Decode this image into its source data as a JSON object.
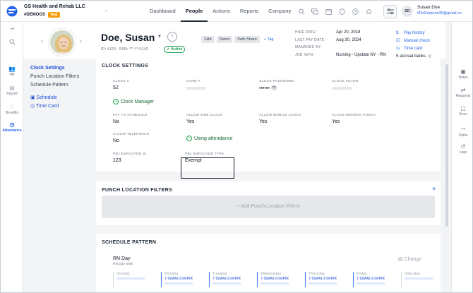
{
  "header": {
    "company": "GS Health and Rehab LLC",
    "company_code": "#DEMOGS",
    "env_badge": "Test",
    "nav": [
      "Dashboard",
      "People",
      "Actions",
      "Reports",
      "Company"
    ],
    "active_nav": "People",
    "user_initials": "SD",
    "user_name": "Susan Doe",
    "user_email": "0DeEmpeon30@gmail.co"
  },
  "left_rail": [
    {
      "label": "HR",
      "icon": "people-icon"
    },
    {
      "label": "Payroll",
      "icon": "payroll-icon"
    },
    {
      "label": "Benefits",
      "icon": "benefits-icon"
    },
    {
      "label": "Attendance",
      "icon": "clock-icon",
      "active": true
    }
  ],
  "right_rail": [
    {
      "label": "Notes",
      "icon": "notes-icon"
    },
    {
      "label": "Requests",
      "icon": "requests-icon"
    },
    {
      "label": "Docs",
      "icon": "docs-icon"
    },
    {
      "label": "Paths",
      "icon": "paths-icon"
    },
    {
      "label": "Logs",
      "icon": "logs-icon"
    }
  ],
  "profile": {
    "name": "Doe, Susan",
    "ids": "ID: #123 · SSN: ***-**-5143",
    "status": "Active",
    "tags": [
      "24ht",
      "Demo",
      "Path Share"
    ],
    "add_tag": "+ Tag",
    "meta": [
      {
        "label": "HIRE DATE:",
        "value": "Apr 20, 2018"
      },
      {
        "label": "LAST PAY DATE:",
        "value": "Aug 30, 2024"
      },
      {
        "label": "MANAGED BY:",
        "value": ""
      },
      {
        "label": "JOB INFO:",
        "value": "Nursing - Upstate NY - RN"
      }
    ],
    "links": [
      "Pay history",
      "Manual check",
      "Time card"
    ],
    "accrual_banks": "5 accrual banks"
  },
  "subnav": {
    "items": [
      "Clock Settings",
      "Punch Location Filters",
      "Schedule Pattern"
    ],
    "active": "Clock Settings",
    "schedule": "Schedule",
    "time_card": "Time Card"
  },
  "clock_settings": {
    "title": "CLOCK SETTINGS",
    "clock_num_label": "CLOCK #",
    "clock_num": "52",
    "card_label": "CARD #",
    "password_label": "CLOCK PASSWORD",
    "password_mask": "••••••",
    "filter_label": "CLOCK FILTER",
    "clock_manager": "Clock Manager",
    "pay_to_schedule_label": "PAY TO SCHEDULE",
    "pay_to_schedule": "No",
    "web_clock_label": "ALLOW WEB CLOCK",
    "web_clock": "Yes",
    "mobile_clock_label": "ALLOW MOBILE CLOCK",
    "mobile_clock": "Yes",
    "missing_punch_label": "ALLOW MISSING PUNCH",
    "missing_punch": "Yes",
    "telepunch_label": "ALLOW TELEPUNCH",
    "telepunch": "No",
    "using_attendance": "Using attendance",
    "pbj_id_label": "PBJ EMPLOYEE ID",
    "pbj_id": "123",
    "pbj_type_label": "PBJ EMPLOYEE TYPE",
    "pbj_type": "Exempt"
  },
  "punch_filters": {
    "title": "PUNCH LOCATION FILTERS",
    "add_label": "+ Add Punch Location Filters"
  },
  "schedule_pattern": {
    "title": "SCHEDULE PATTERN",
    "shift_name": "RN Day",
    "shift_sub": "RN Day Shift",
    "change": "Change",
    "days": [
      {
        "name": "Sunday",
        "time": ""
      },
      {
        "name": "Monday",
        "time": "7:00AM-3:00PM"
      },
      {
        "name": "Tuesday",
        "time": "7:00AM-3:00PM"
      },
      {
        "name": "Wednesday",
        "time": "7:00AM-3:00PM"
      },
      {
        "name": "Thursday",
        "time": "7:00AM-3:00PM"
      },
      {
        "name": "Friday",
        "time": "7:00AM-3:00PM"
      },
      {
        "name": "Saturday",
        "time": ""
      }
    ]
  },
  "colors": {
    "accent": "#2563eb",
    "active_green": "#16a34a",
    "test_badge": "#f59e0b"
  }
}
